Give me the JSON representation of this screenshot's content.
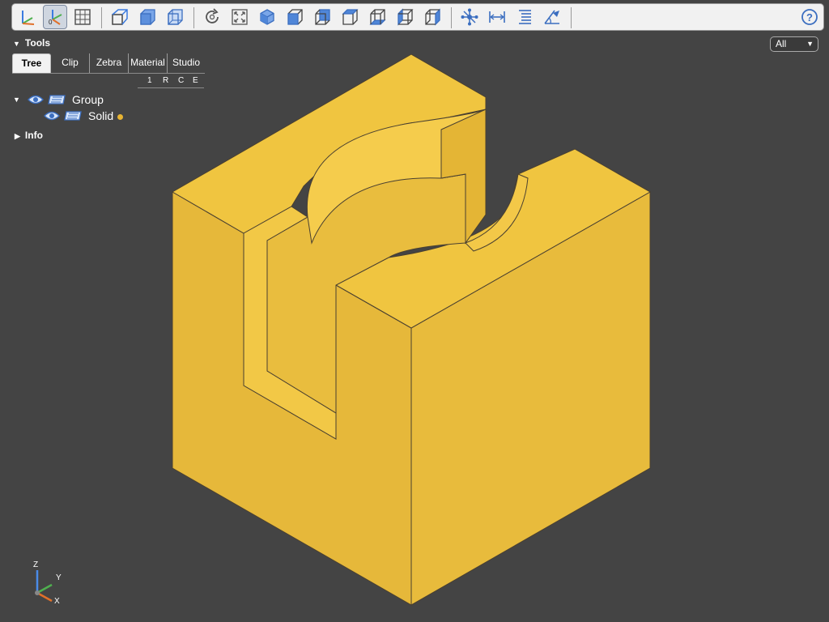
{
  "toolbar": {
    "buttons": [
      {
        "name": "axes-toggle-icon",
        "active": false
      },
      {
        "name": "axes-origin-icon",
        "active": true
      },
      {
        "name": "grid-icon",
        "active": false
      },
      {
        "name": "perspective-icon",
        "active": false
      },
      {
        "name": "solid-box-icon",
        "active": false
      },
      {
        "name": "transparent-box-icon",
        "active": false
      },
      {
        "name": "reset-view-icon",
        "active": false
      },
      {
        "name": "fit-view-icon",
        "active": false
      },
      {
        "name": "iso-view-icon",
        "active": false
      },
      {
        "name": "front-view-icon",
        "active": false
      },
      {
        "name": "back-view-icon",
        "active": false
      },
      {
        "name": "top-view-icon",
        "active": false
      },
      {
        "name": "bottom-view-icon",
        "active": false
      },
      {
        "name": "left-view-icon",
        "active": false
      },
      {
        "name": "right-view-icon",
        "active": false
      },
      {
        "name": "explode-icon",
        "active": false
      },
      {
        "name": "distance-measure-icon",
        "active": false
      },
      {
        "name": "properties-icon",
        "active": false
      },
      {
        "name": "angle-measure-icon",
        "active": false
      }
    ],
    "help_icon": "help-icon"
  },
  "tools": {
    "title": "Tools",
    "tabs": [
      "Tree",
      "Clip",
      "Zebra",
      "Material",
      "Studio"
    ],
    "active_tab": "Tree",
    "columns": [
      "1",
      "R",
      "C",
      "E"
    ]
  },
  "tree": {
    "group_label": "Group",
    "solid_label": "Solid",
    "solid_color": "#e8b432"
  },
  "info": {
    "title": "Info"
  },
  "filter": {
    "value": "All"
  },
  "axes_indicator": {
    "z": "Z",
    "y": "Y",
    "x": "X"
  },
  "colors": {
    "background": "#444444",
    "model_top": "#f0c540",
    "model_left": "#e6b83a",
    "model_right": "#e8bb3c",
    "edge": "#4a4030"
  }
}
